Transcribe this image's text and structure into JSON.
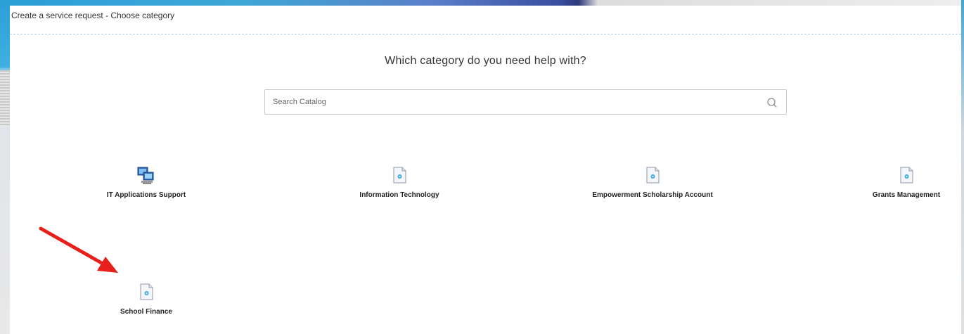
{
  "dialog": {
    "title": "Create a service request - Choose category"
  },
  "main": {
    "heading": "Which category do you need help with?",
    "search": {
      "placeholder": "Search Catalog",
      "value": ""
    },
    "categories": [
      {
        "label": "IT Applications Support",
        "icon": "computers-icon"
      },
      {
        "label": "Information Technology",
        "icon": "document-icon"
      },
      {
        "label": "Empowerment Scholarship Account",
        "icon": "document-icon"
      },
      {
        "label": "Grants Management",
        "icon": "document-icon"
      },
      {
        "label": "School Finance",
        "icon": "document-icon"
      }
    ]
  },
  "annotation": {
    "arrow_color": "#e8201c"
  }
}
